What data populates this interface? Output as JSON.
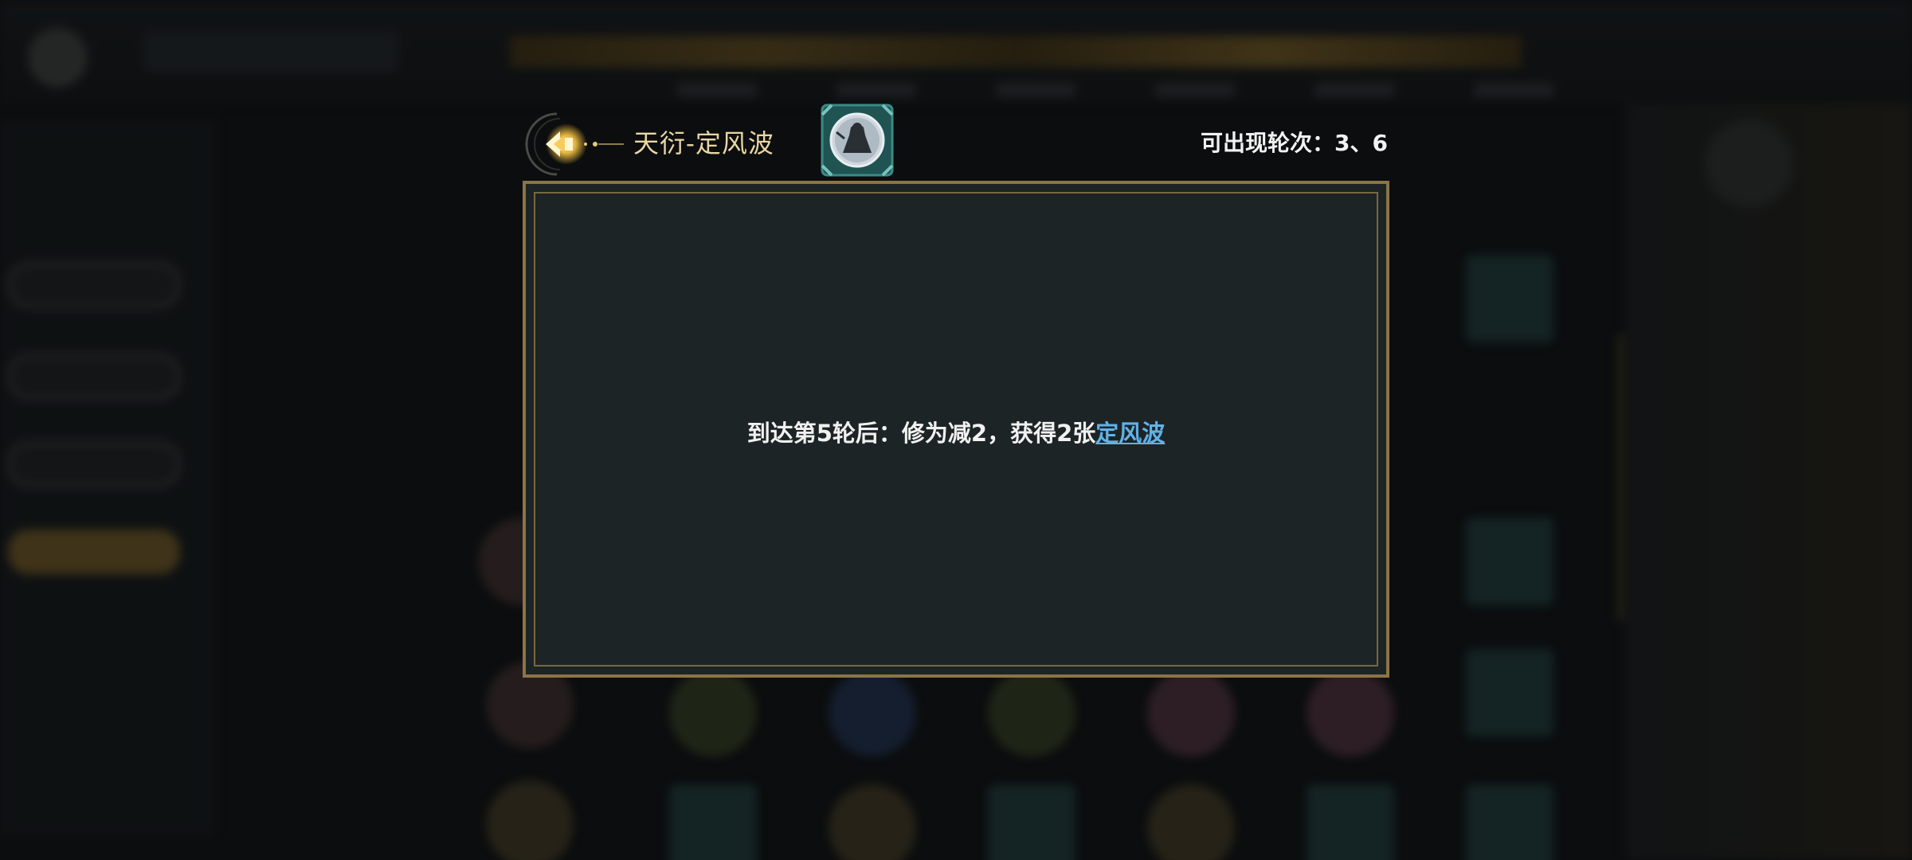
{
  "dialog": {
    "title": "天衍-定风波",
    "rounds_label": "可出现轮次：",
    "rounds_values": "3、6",
    "description_prefix": "到达第5轮后：修为减2，获得2张",
    "description_link": "定风波"
  },
  "colors": {
    "title_gold": "#e9d6a3",
    "panel_bg": "#1d2425",
    "panel_border": "#8b7446",
    "link_blue": "#5fb2ea",
    "back_arrow_glow": "#f5c242"
  },
  "icons": {
    "back": "back-arrow-icon",
    "card": "card-portrait-icon"
  }
}
